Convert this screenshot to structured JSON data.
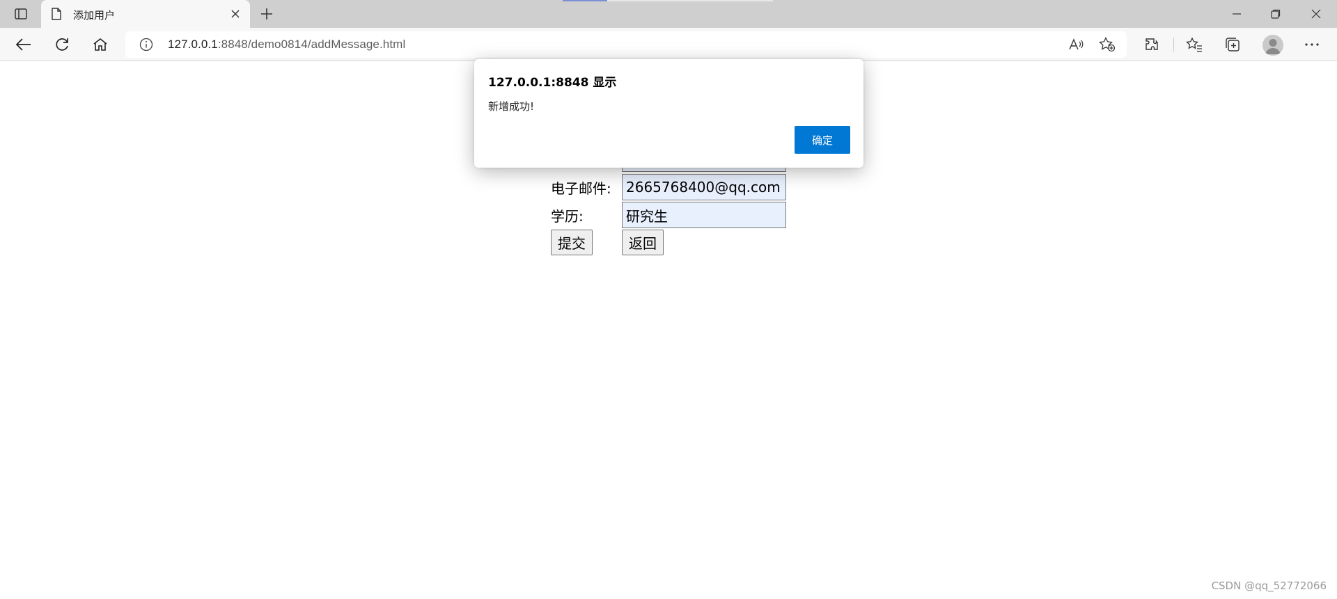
{
  "browser": {
    "tab_title": "添加用户",
    "url_host": "127.0.0.1",
    "url_path": ":8848/demo0814/addMessage.html"
  },
  "form": {
    "email_label": "电子邮件:",
    "email_value": "2665768400@qq.com",
    "education_label": "学历:",
    "education_value": "研究生",
    "submit_label": "提交",
    "back_label": "返回"
  },
  "dialog": {
    "title": "127.0.0.1:8848 显示",
    "message": "新增成功!",
    "ok_label": "确定"
  },
  "watermark": "CSDN @qq_52772066",
  "colors": {
    "accent": "#0078d4",
    "input_autofill": "#e8f0fe"
  }
}
